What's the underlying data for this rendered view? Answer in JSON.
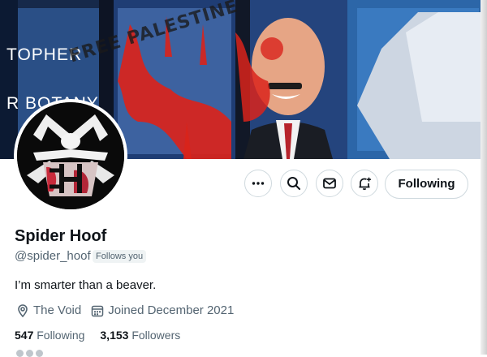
{
  "banner": {
    "sign_line_1": "TOPHER",
    "sign_line_2": "R BOTANY",
    "graffiti": "FREE PALESTINE"
  },
  "actions": {
    "more_icon": "more-icon",
    "search_icon": "search-icon",
    "message_icon": "message-icon",
    "notify_icon": "bell-plus-icon",
    "follow_label": "Following"
  },
  "profile": {
    "name": "Spider Hoof",
    "handle": "@spider_hoof",
    "follows_you": "Follows you",
    "bio": "I’m smarter than a beaver.",
    "location": "The Void",
    "joined": "Joined December 2021",
    "following_count": "547",
    "following_label": "Following",
    "followers_count": "3,153",
    "followers_label": "Followers"
  },
  "colors": {
    "primary_text": "#0f1419",
    "secondary_text": "#536471",
    "border": "#cfd9de",
    "paint_red": "#d9231b"
  }
}
